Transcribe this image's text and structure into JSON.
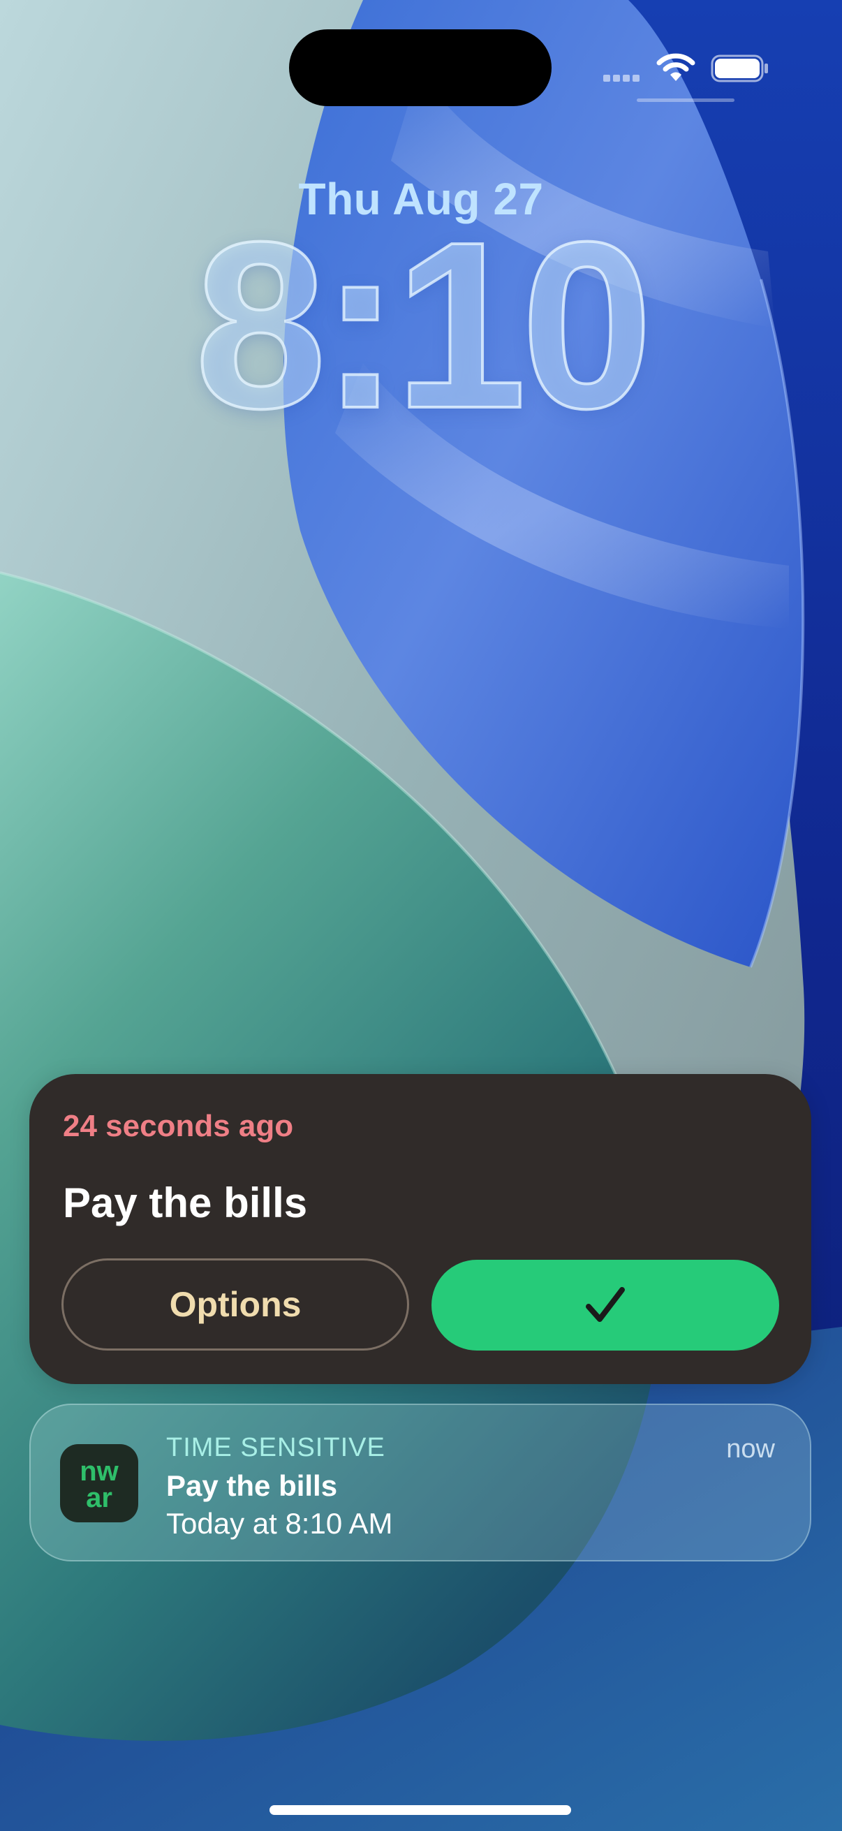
{
  "status_bar": {
    "wifi_icon": "wifi-icon",
    "battery_icon": "battery-full-icon",
    "cellular_icon": "no-signal-dots-icon"
  },
  "lock_screen": {
    "date": "Thu Aug 27",
    "time": "8:10"
  },
  "live_activity": {
    "elapsed": "24 seconds ago",
    "title": "Pay the bills",
    "options_label": "Options",
    "done_icon": "checkmark-icon",
    "colors": {
      "background": "#302b29",
      "elapsed_text": "#ef7f86",
      "options_text": "#f0dcae",
      "done_button": "#26cb79"
    }
  },
  "notification": {
    "app_icon_text": "nwar",
    "tag": "TIME SENSITIVE",
    "title": "Pay the bills",
    "body": "Today at 8:10 AM",
    "time": "now"
  }
}
